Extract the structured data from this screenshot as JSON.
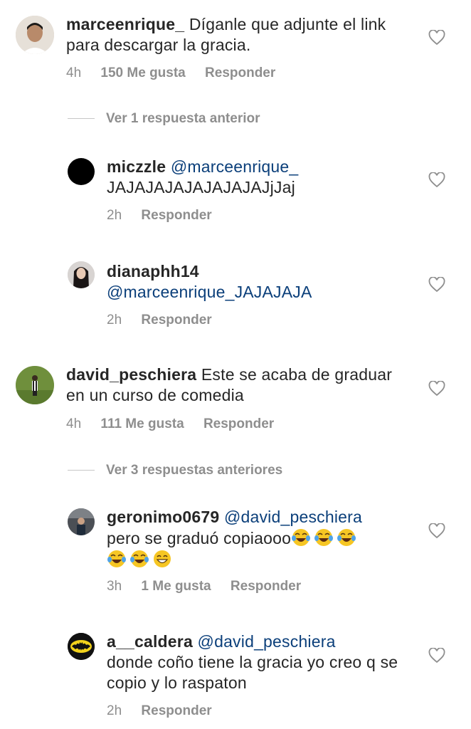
{
  "comments": [
    {
      "username": "marceenrique_",
      "text": "Díganle que adjunte el link para descargar la gracia.",
      "time": "4h",
      "likes": "150 Me gusta",
      "reply_label": "Responder",
      "view_replies": "Ver 1 respuesta anterior",
      "replies": [
        {
          "username": "miczzle",
          "mention": "@marceenrique_",
          "text": "JAJAJAJAJAJAJAJAJjJaj",
          "time": "2h",
          "reply_label": "Responder"
        },
        {
          "username": "dianaphh14",
          "mention": "@marceenrique_JAJAJAJA",
          "text": "",
          "time": "2h",
          "reply_label": "Responder"
        }
      ]
    },
    {
      "username": "david_peschiera",
      "text": "Este se acaba de graduar en un curso de comedia",
      "time": "4h",
      "likes": "111 Me gusta",
      "reply_label": "Responder",
      "view_replies": "Ver 3 respuestas anteriores",
      "replies": [
        {
          "username": "geronimo0679",
          "mention": "@david_peschiera",
          "text": "pero se graduó copiaooo",
          "time": "3h",
          "likes": "1 Me gusta",
          "reply_label": "Responder"
        },
        {
          "username": "a__caldera",
          "mention": "@david_peschiera",
          "text": "donde coño tiene la gracia yo creo q se copio y lo raspaton",
          "time": "2h",
          "reply_label": "Responder"
        }
      ]
    }
  ],
  "colors": {
    "mention": "#0b3f7a",
    "meta": "#8e8e8e",
    "text": "#262626"
  },
  "icons": {
    "like": "heart-outline-icon",
    "laugh": "laughing-tears-emoji",
    "grin": "grinning-emoji"
  }
}
